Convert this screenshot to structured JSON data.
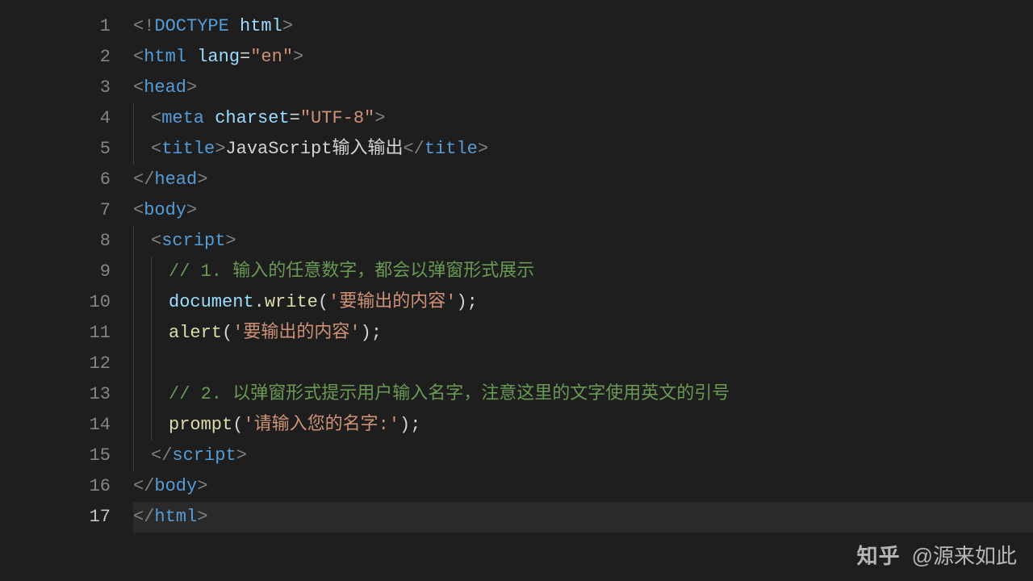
{
  "activeLine": 17,
  "lines": [
    {
      "n": 1,
      "indent": 0,
      "tokens": [
        [
          "pun",
          "<!"
        ],
        [
          "tag",
          "DOCTYPE"
        ],
        [
          "txt",
          " "
        ],
        [
          "attr",
          "html"
        ],
        [
          "pun",
          ">"
        ]
      ]
    },
    {
      "n": 2,
      "indent": 0,
      "tokens": [
        [
          "pun",
          "<"
        ],
        [
          "tag",
          "html"
        ],
        [
          "txt",
          " "
        ],
        [
          "attr",
          "lang"
        ],
        [
          "txt",
          "="
        ],
        [
          "str",
          "\"en\""
        ],
        [
          "pun",
          ">"
        ]
      ]
    },
    {
      "n": 3,
      "indent": 0,
      "tokens": [
        [
          "pun",
          "<"
        ],
        [
          "tag",
          "head"
        ],
        [
          "pun",
          ">"
        ]
      ]
    },
    {
      "n": 4,
      "indent": 1,
      "tokens": [
        [
          "pun",
          "<"
        ],
        [
          "tag",
          "meta"
        ],
        [
          "txt",
          " "
        ],
        [
          "attr",
          "charset"
        ],
        [
          "txt",
          "="
        ],
        [
          "str",
          "\"UTF-8\""
        ],
        [
          "pun",
          ">"
        ]
      ]
    },
    {
      "n": 5,
      "indent": 1,
      "tokens": [
        [
          "pun",
          "<"
        ],
        [
          "tag",
          "title"
        ],
        [
          "pun",
          ">"
        ],
        [
          "txt",
          "JavaScript输入输出"
        ],
        [
          "pun",
          "</"
        ],
        [
          "tag",
          "title"
        ],
        [
          "pun",
          ">"
        ]
      ]
    },
    {
      "n": 6,
      "indent": 0,
      "tokens": [
        [
          "pun",
          "</"
        ],
        [
          "tag",
          "head"
        ],
        [
          "pun",
          ">"
        ]
      ]
    },
    {
      "n": 7,
      "indent": 0,
      "tokens": [
        [
          "pun",
          "<"
        ],
        [
          "tag",
          "body"
        ],
        [
          "pun",
          ">"
        ]
      ]
    },
    {
      "n": 8,
      "indent": 1,
      "tokens": [
        [
          "pun",
          "<"
        ],
        [
          "tag",
          "script"
        ],
        [
          "pun",
          ">"
        ]
      ]
    },
    {
      "n": 9,
      "indent": 2,
      "tokens": [
        [
          "cmt",
          "// 1. 输入的任意数字，都会以弹窗形式展示"
        ]
      ]
    },
    {
      "n": 10,
      "indent": 2,
      "tokens": [
        [
          "obj",
          "document"
        ],
        [
          "txt",
          "."
        ],
        [
          "fn",
          "write"
        ],
        [
          "paren",
          "("
        ],
        [
          "str",
          "'要输出的内容'"
        ],
        [
          "paren",
          ")"
        ],
        [
          "txt",
          ";"
        ]
      ]
    },
    {
      "n": 11,
      "indent": 2,
      "tokens": [
        [
          "fn",
          "alert"
        ],
        [
          "paren",
          "("
        ],
        [
          "str",
          "'要输出的内容'"
        ],
        [
          "paren",
          ")"
        ],
        [
          "txt",
          ";"
        ]
      ]
    },
    {
      "n": 12,
      "indent": 2,
      "tokens": []
    },
    {
      "n": 13,
      "indent": 2,
      "tokens": [
        [
          "cmt",
          "// 2. 以弹窗形式提示用户输入名字，注意这里的文字使用英文的引号"
        ]
      ]
    },
    {
      "n": 14,
      "indent": 2,
      "tokens": [
        [
          "fn",
          "prompt"
        ],
        [
          "paren",
          "("
        ],
        [
          "str",
          "'请输入您的名字:'"
        ],
        [
          "paren",
          ")"
        ],
        [
          "txt",
          ";"
        ]
      ]
    },
    {
      "n": 15,
      "indent": 1,
      "tokens": [
        [
          "pun",
          "</"
        ],
        [
          "tag",
          "script"
        ],
        [
          "pun",
          ">"
        ]
      ]
    },
    {
      "n": 16,
      "indent": 0,
      "tokens": [
        [
          "pun",
          "</"
        ],
        [
          "tag",
          "body"
        ],
        [
          "pun",
          ">"
        ]
      ]
    },
    {
      "n": 17,
      "indent": 0,
      "tokens": [
        [
          "pun",
          "</"
        ],
        [
          "tag",
          "html"
        ],
        [
          "pun",
          ">"
        ]
      ]
    }
  ],
  "watermark": {
    "logo": "知乎",
    "author": "@源来如此"
  }
}
